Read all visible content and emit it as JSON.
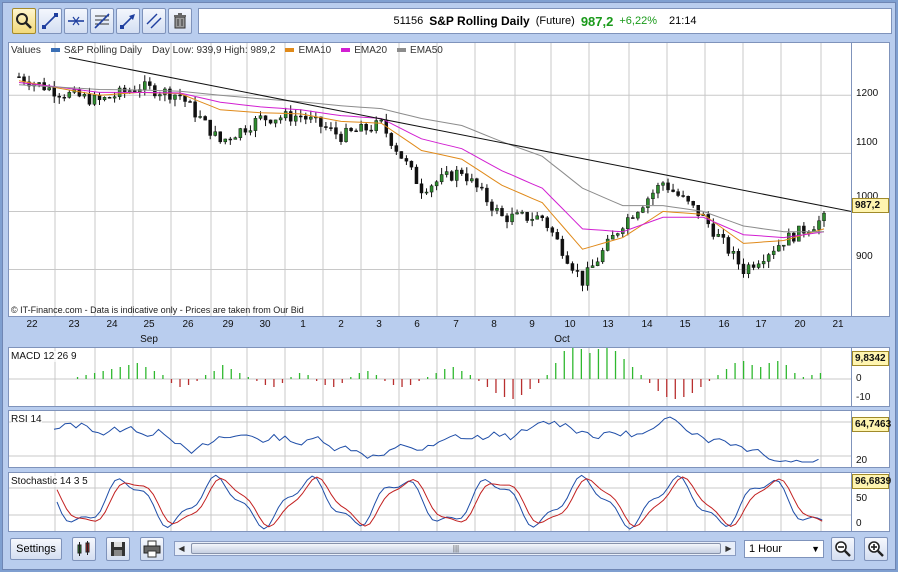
{
  "toolbar": {
    "tools": [
      {
        "name": "zoom-tool",
        "icon": "magnifier-icon"
      },
      {
        "name": "draw-line-tool",
        "icon": "line-icon"
      },
      {
        "name": "horizontal-line-tool",
        "icon": "horizontal-line-icon"
      },
      {
        "name": "fibonacci-tool",
        "icon": "fibonacci-icon"
      },
      {
        "name": "arrow-line-tool",
        "icon": "arrow-icon"
      },
      {
        "name": "parallel-line-tool",
        "icon": "parallel-icon"
      },
      {
        "name": "delete-tool",
        "icon": "trash-icon"
      }
    ],
    "quote": {
      "code": "51156",
      "name": "S&P Rolling Daily",
      "type": "(Future)",
      "price": "987,2",
      "change": "+6,22%",
      "time": "21:14"
    }
  },
  "main_chart": {
    "legend": {
      "values_label": "Values",
      "series_label": "S&P Rolling Daily",
      "day_range": "Day Low: 939,9 High: 989,2",
      "ema10": "EMA10",
      "ema20": "EMA20",
      "ema50": "EMA50"
    },
    "disclaimer": "© IT-Finance.com - Data is indicative only - Prices are taken from Our Bid",
    "y_ticks": [
      "1200",
      "1100",
      "1000",
      "900"
    ],
    "last_value": "987,2",
    "colors": {
      "up": "#2e8b2e",
      "down": "#111111",
      "ema10": "#e08a1a",
      "ema20": "#d21fd2",
      "ema50": "#8c8c8c",
      "price_line": "#3b6fb5"
    }
  },
  "date_axis": {
    "days": [
      "22",
      "23",
      "24",
      "25",
      "26",
      "29",
      "30",
      "1",
      "2",
      "3",
      "6",
      "7",
      "8",
      "9",
      "10",
      "13",
      "14",
      "15",
      "16",
      "17",
      "20",
      "21"
    ],
    "months": [
      "Sep",
      "Oct"
    ]
  },
  "macd": {
    "label": "MACD 12 26 9",
    "y_ticks": [
      "0",
      "-10"
    ],
    "last_value": "9,8342"
  },
  "rsi": {
    "label": "RSI 14",
    "y_ticks": [
      "20"
    ],
    "last_value": "64,7463"
  },
  "stochastic": {
    "label": "Stochastic 14 3 5",
    "y_ticks": [
      "50",
      "0"
    ],
    "last_value": "96,6839"
  },
  "chart_data": {
    "type": "line",
    "title": "S&P Rolling Daily",
    "categories": [
      "22 Sep",
      "23 Sep",
      "24 Sep",
      "25 Sep",
      "26 Sep",
      "29 Sep",
      "30 Sep",
      "1 Oct",
      "2 Oct",
      "3 Oct",
      "6 Oct",
      "7 Oct",
      "8 Oct",
      "9 Oct",
      "10 Oct",
      "13 Oct",
      "14 Oct",
      "15 Oct",
      "16 Oct",
      "17 Oct",
      "20 Oct"
    ],
    "series": [
      {
        "name": "S&P Rolling Daily",
        "values": [
          1232,
          1205,
          1190,
          1215,
          1200,
          1120,
          1160,
          1165,
          1130,
          1150,
          1040,
          1070,
          990,
          990,
          880,
          980,
          1050,
          990,
          900,
          950,
          987.2
        ]
      },
      {
        "name": "EMA10",
        "values": [
          1225,
          1212,
          1200,
          1205,
          1203,
          1175,
          1170,
          1168,
          1155,
          1152,
          1105,
          1090,
          1045,
          1015,
          935,
          955,
          1000,
          995,
          945,
          950,
          970
        ]
      },
      {
        "name": "EMA20",
        "values": [
          1222,
          1214,
          1205,
          1205,
          1204,
          1188,
          1180,
          1175,
          1165,
          1160,
          1125,
          1108,
          1070,
          1040,
          970,
          965,
          990,
          990,
          960,
          955,
          965
        ]
      },
      {
        "name": "EMA50",
        "values": [
          1218,
          1214,
          1210,
          1209,
          1207,
          1200,
          1194,
          1189,
          1182,
          1177,
          1160,
          1148,
          1120,
          1095,
          1040,
          1010,
          1010,
          1000,
          975,
          965,
          965
        ]
      }
    ],
    "ylim": [
      820,
      1290
    ],
    "y_ticks": [
      1200,
      1100,
      1000,
      900
    ],
    "grid": true,
    "legend_position": "top-left"
  }
}
